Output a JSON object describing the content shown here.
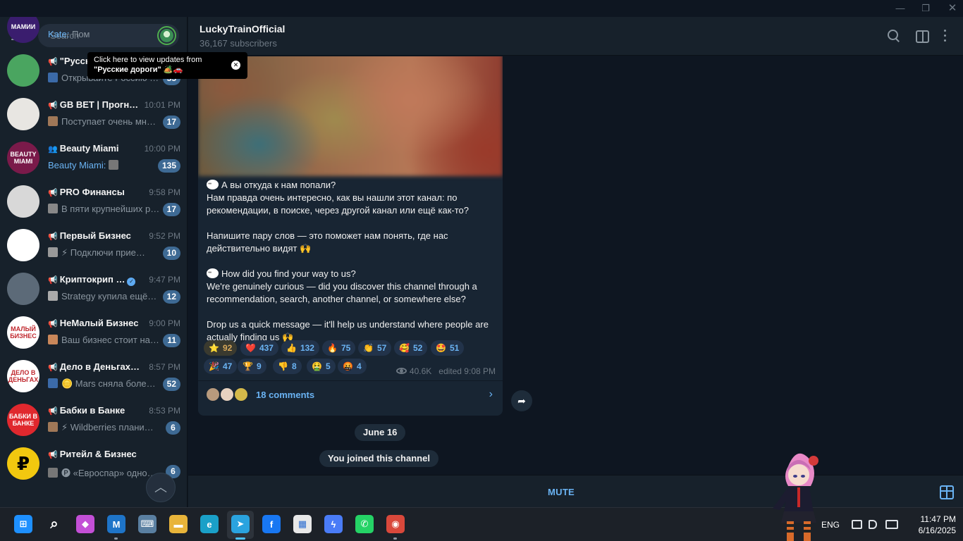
{
  "window": {
    "minimize_glyph": "—",
    "maximize_glyph": "❐",
    "close_glyph": "✕"
  },
  "sidebar": {
    "search_placeholder": "Search",
    "tooltip": {
      "line1": "Click here to view updates from",
      "line2": "\"Русские дороги\" 🏕️🚗",
      "close": "✕"
    },
    "chats": [
      {
        "title": "",
        "time": "",
        "sender": "Kate:",
        "message": "Пом",
        "badge": "",
        "avatar_text": "МАМИИ",
        "avatar_color": "#3a1d6e"
      },
      {
        "title": "\"Русские дорог…",
        "time": "10:19 PM",
        "sender": "",
        "message": "Открывайте Россию …",
        "badge": "55",
        "avatar_text": "",
        "avatar_color": "#4aa560"
      },
      {
        "title": "GB BET | Прогн…",
        "time": "10:01 PM",
        "sender": "",
        "message": "Поступает очень много…",
        "badge": "17",
        "avatar_text": "",
        "avatar_color": "#e8e6e2"
      },
      {
        "title": "Beauty Miami",
        "time": "10:00 PM",
        "sender": "Beauty Miami:",
        "message": "",
        "badge": "135",
        "avatar_text": "BEAUTY MIAMI",
        "avatar_color": "#7a1a4a"
      },
      {
        "title": "PRO Финансы",
        "time": "9:58 PM",
        "sender": "",
        "message": "В пяти крупнейших рос…",
        "badge": "17",
        "avatar_text": "",
        "avatar_color": "#d8d8d8"
      },
      {
        "title": "Первый Бизнес",
        "time": "9:52 PM",
        "sender": "",
        "message": "⚡ Подключи прие…",
        "badge": "10",
        "avatar_text": "",
        "avatar_color": "#ffffff"
      },
      {
        "title": "Криптокрип …",
        "time": "9:47 PM",
        "sender": "",
        "message": "Strategy купила ещё…",
        "badge": "12",
        "avatar_text": "",
        "avatar_color": "#5c6a78"
      },
      {
        "title": "НеМалый Бизнес",
        "time": "9:00 PM",
        "sender": "",
        "message": "Ваш бизнес стоит на ме…",
        "badge": "11",
        "avatar_text": "МАЛЫЙ БИЗНЕС",
        "avatar_color": "#ffffff"
      },
      {
        "title": "Дело в Деньгах …",
        "time": "8:57 PM",
        "sender": "",
        "message": "🪙 Mars сняла боле…",
        "badge": "52",
        "avatar_text": "ДЕЛО В ДЕНЬГАХ",
        "avatar_color": "#ffffff"
      },
      {
        "title": "Бабки в Банке",
        "time": "8:53 PM",
        "sender": "",
        "message": "⚡ Wildberries плани…",
        "badge": "6",
        "avatar_text": "БАБКИ В БАНКЕ",
        "avatar_color": "#e0282e"
      },
      {
        "title": "Ритейл & Бизнес",
        "time": "",
        "sender": "",
        "message": "🅟 «Евроспар» одно…",
        "badge": "6",
        "avatar_text": "₽",
        "avatar_color": "#f2c80f"
      }
    ],
    "scroll_top_glyph": "︿"
  },
  "header": {
    "title": "LuckyTrainOfficial",
    "subtitle": "36,167 subscribers"
  },
  "post": {
    "paragraphs": [
      {
        "bubble": true,
        "text": "А вы откуда к нам попали?"
      },
      {
        "bubble": false,
        "text": "Нам правда очень интересно, как вы нашли этот канал: по рекомендации, в поиске, через другой канал или ещё как-то?"
      },
      {
        "bubble": false,
        "text": "Напишите пару слов — это поможет нам понять, где нас действительно видят 🙌"
      },
      {
        "bubble": true,
        "text": "How did you find your way to us?"
      },
      {
        "bubble": false,
        "text": "We're genuinely curious — did you discover this channel through a recommendation, search, another channel, or somewhere else?"
      },
      {
        "bubble": false,
        "text": "Drop us a quick message — it'll help us understand where people are actually finding us 🙌"
      }
    ],
    "reactions": [
      {
        "emoji": "⭐",
        "count": "92",
        "mine": true
      },
      {
        "emoji": "❤️",
        "count": "437",
        "mine": false
      },
      {
        "emoji": "👍",
        "count": "132",
        "mine": false
      },
      {
        "emoji": "🔥",
        "count": "75",
        "mine": false
      },
      {
        "emoji": "👏",
        "count": "57",
        "mine": false
      },
      {
        "emoji": "🥰",
        "count": "52",
        "mine": false
      },
      {
        "emoji": "🤩",
        "count": "51",
        "mine": false
      },
      {
        "emoji": "🎉",
        "count": "47",
        "mine": false
      },
      {
        "emoji": "🏆",
        "count": "9",
        "mine": false
      },
      {
        "emoji": "👎",
        "count": "8",
        "mine": false
      },
      {
        "emoji": "🤮",
        "count": "5",
        "mine": false
      },
      {
        "emoji": "🤬",
        "count": "4",
        "mine": false
      }
    ],
    "views": "40.6K",
    "edited": "edited 9:08 PM",
    "comments": "18 comments",
    "comments_arrow": "›",
    "share_glyph": "➦"
  },
  "service": {
    "date": "June 16",
    "joined": "You joined this channel"
  },
  "bottom": {
    "mute": "MUTE"
  },
  "taskbar": {
    "lang": "ENG",
    "time": "11:47 PM",
    "date": "6/16/2025",
    "apps": [
      {
        "name": "start",
        "label": "⊞",
        "color": "#1e90ff"
      },
      {
        "name": "search",
        "label": "⌕",
        "color": "transparent"
      },
      {
        "name": "copilot",
        "label": "◆",
        "color": "#c34fd6"
      },
      {
        "name": "mail",
        "label": "M",
        "color": "#1e74c8"
      },
      {
        "name": "keyboard",
        "label": "⌨",
        "color": "#5a7fa1"
      },
      {
        "name": "explorer",
        "label": "▬",
        "color": "#e8b43a"
      },
      {
        "name": "edge",
        "label": "e",
        "color": "#1aa0c8"
      },
      {
        "name": "telegram",
        "label": "➤",
        "color": "#2aa3df"
      },
      {
        "name": "facebook",
        "label": "f",
        "color": "#1877f2"
      },
      {
        "name": "store",
        "label": "▦",
        "color": "#e8e8e8"
      },
      {
        "name": "messenger",
        "label": "ϟ",
        "color": "#4a7cf7"
      },
      {
        "name": "whatsapp",
        "label": "✆",
        "color": "#25d366"
      },
      {
        "name": "chrome",
        "label": "◉",
        "color": "#d9483b"
      }
    ]
  }
}
